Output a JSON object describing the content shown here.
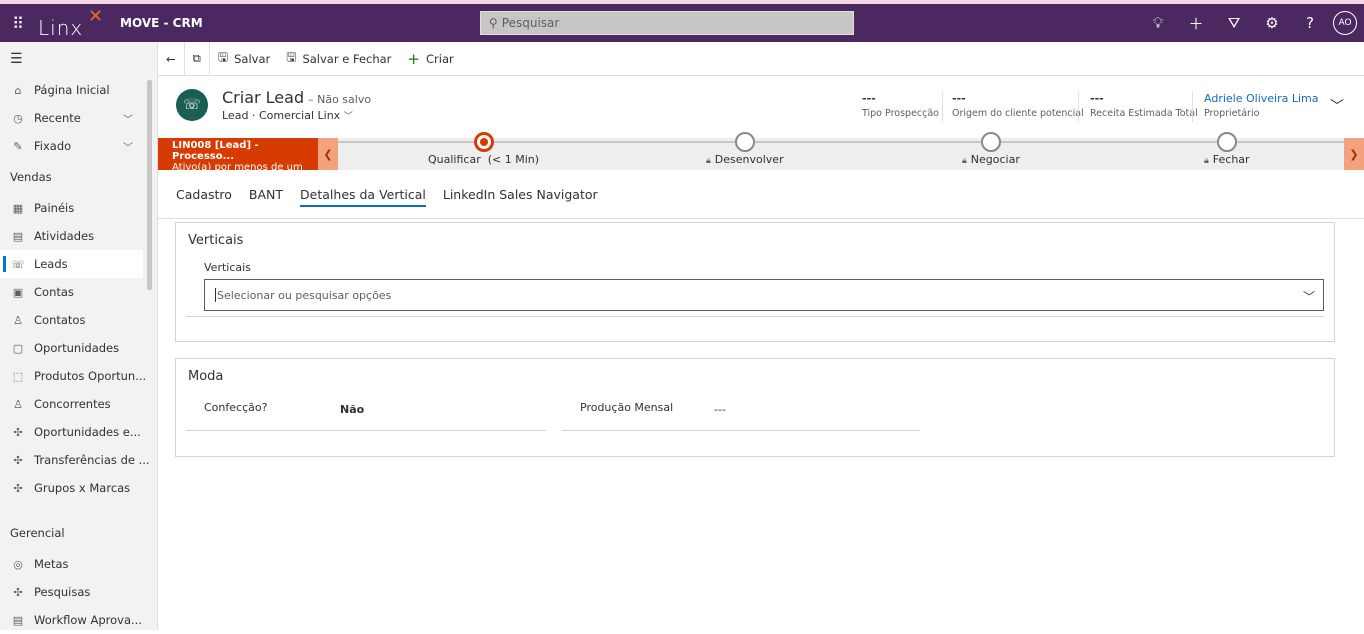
{
  "topbar": {
    "logo": "Linx",
    "app_name": "MOVE - CRM",
    "search_placeholder": "Pesquisar",
    "avatar_initials": "AO"
  },
  "commands": {
    "save": "Salvar",
    "save_close": "Salvar e Fechar",
    "create": "Criar"
  },
  "sidebar": {
    "home": "Página Inicial",
    "recent": "Recente",
    "pinned": "Fixado",
    "section_sales": "Vendas",
    "sales_items": [
      "Painéis",
      "Atividades",
      "Leads",
      "Contas",
      "Contatos",
      "Oportunidades",
      "Produtos Oportun...",
      "Concorrentes",
      "Oportunidades e...",
      "Transferências de ...",
      "Grupos x Marcas"
    ],
    "section_management": "Gerencial",
    "management_items": [
      "Metas",
      "Pesquisas",
      "Workflow Aprova..."
    ]
  },
  "header": {
    "title": "Criar Lead",
    "unsaved": "– Não salvo",
    "entity": "Lead",
    "form": "Comercial Linx",
    "fields": [
      {
        "value": "---",
        "label": "Tipo Prospecção"
      },
      {
        "value": "---",
        "label": "Origem do cliente potencial"
      },
      {
        "value": "---",
        "label": "Receita Estimada Total"
      }
    ],
    "owner": {
      "value": "Adriele Oliveira Lima",
      "label": "Proprietário"
    }
  },
  "bpf": {
    "flag_title": "LIN008 [Lead] - Processo...",
    "flag_sub": "Ativo(a) por menos de um ...",
    "stages": [
      {
        "name": "Qualificar",
        "time": "(< 1 Min)"
      },
      {
        "name": "Desenvolver"
      },
      {
        "name": "Negociar"
      },
      {
        "name": "Fechar"
      }
    ]
  },
  "tabs": [
    "Cadastro",
    "BANT",
    "Detalhes da Vertical",
    "LinkedIn Sales Navigator"
  ],
  "sections": {
    "verticais": {
      "title": "Verticais",
      "field_label": "Verticais",
      "placeholder": "Selecionar ou pesquisar opções"
    },
    "moda": {
      "title": "Moda",
      "field1_label": "Confecção?",
      "field1_value": "Não",
      "field2_label": "Produção Mensal",
      "field2_value": "---"
    }
  }
}
